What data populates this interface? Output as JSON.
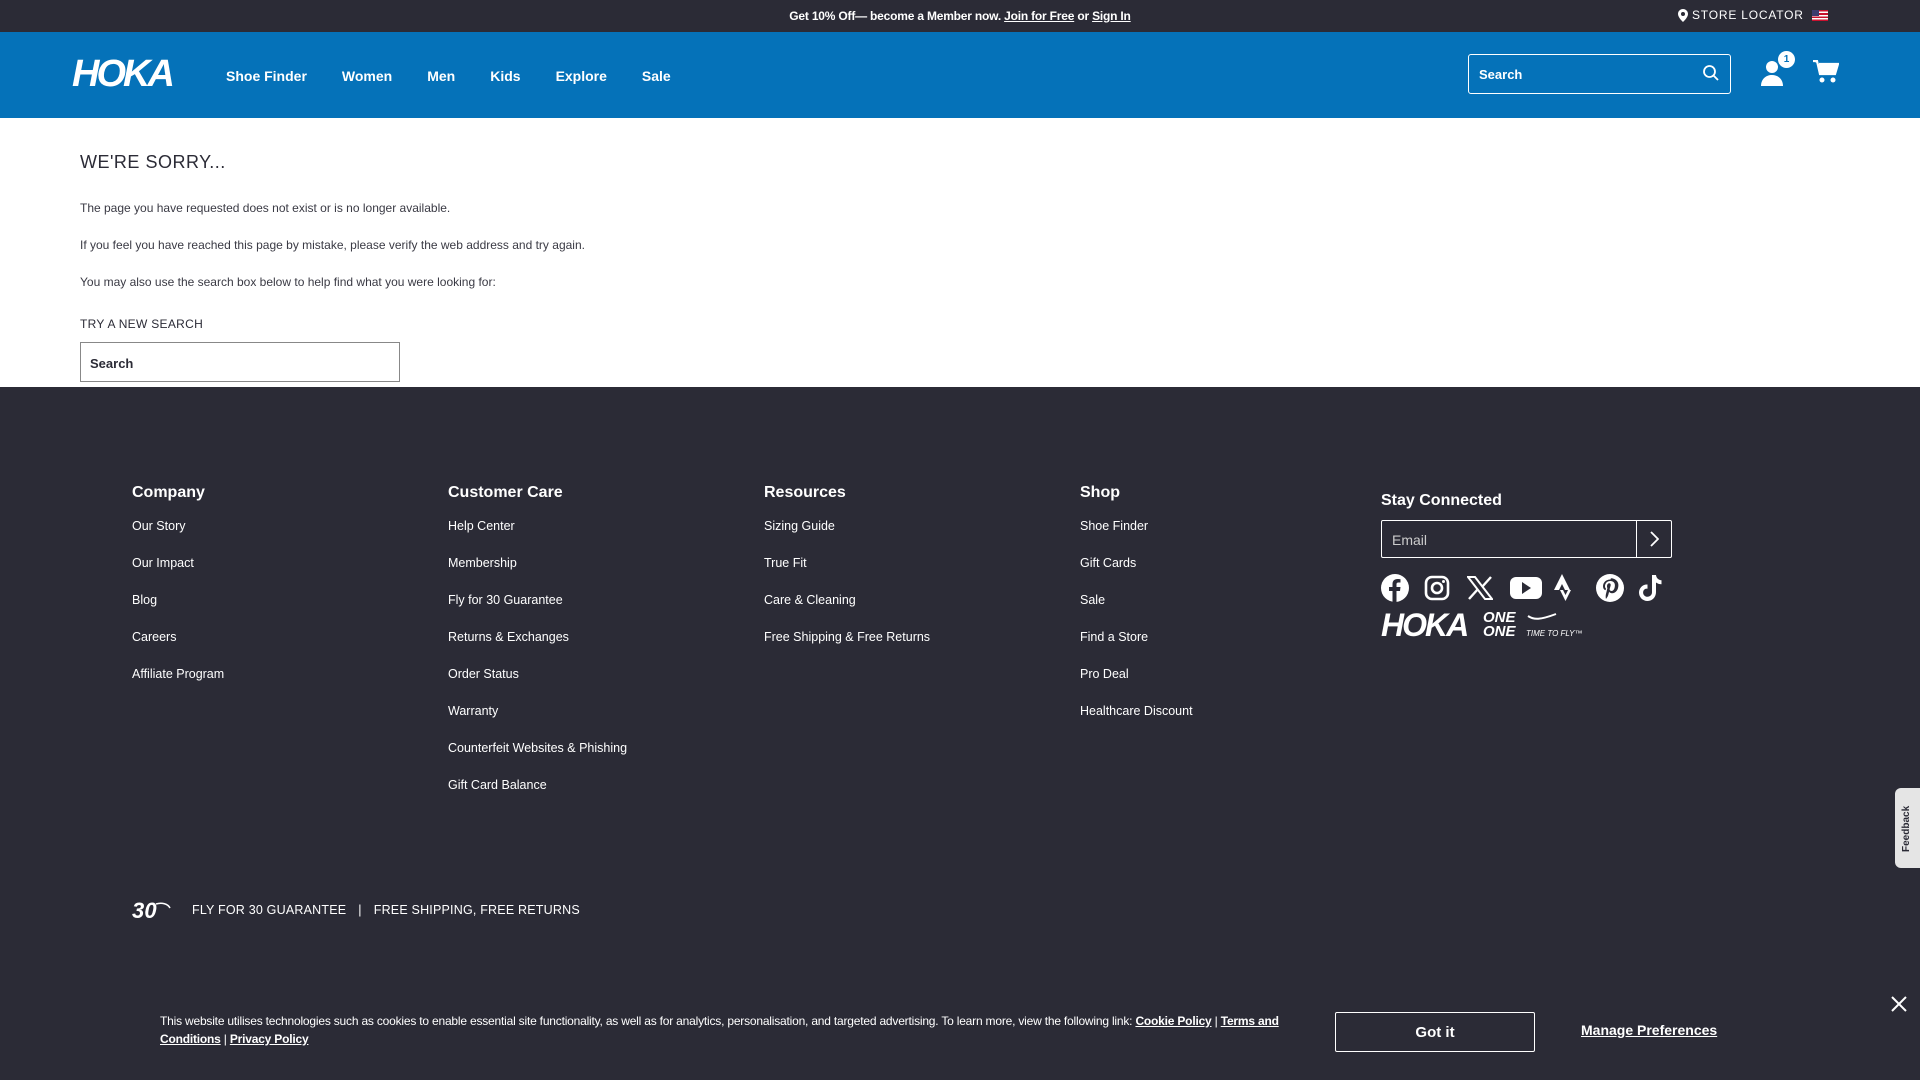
{
  "promo": {
    "text": "Get 10% Off— become a Member now. ",
    "join_link": "Join for Free",
    "or": " or ",
    "signin_link": "Sign In"
  },
  "store_locator": "STORE LOCATOR",
  "header": {
    "logo": "HOKA",
    "nav": [
      "Shoe Finder",
      "Women",
      "Men",
      "Kids",
      "Explore",
      "Sale"
    ],
    "search_placeholder": "Search",
    "cart_badge": "1"
  },
  "content": {
    "title": "WE'RE SORRY...",
    "msg1": "The page you have requested does not exist or is no longer available.",
    "msg2": "If you feel you have reached this page by mistake, please verify the web address and try again.",
    "msg3": "You may also use the search box below to help find what you were looking for:",
    "try_label": "TRY A NEW SEARCH",
    "search_placeholder": "Search"
  },
  "footer": {
    "columns": [
      {
        "heading": "Company",
        "links": [
          "Our Story",
          "Our Impact",
          "Blog",
          "Careers",
          "Affiliate Program"
        ]
      },
      {
        "heading": "Customer Care",
        "links": [
          "Help Center",
          "Membership",
          "Fly for 30 Guarantee",
          "Returns & Exchanges",
          "Order Status",
          "Warranty",
          "Counterfeit Websites & Phishing",
          "Gift Card Balance"
        ]
      },
      {
        "heading": "Resources",
        "links": [
          "Sizing Guide",
          "True Fit",
          "Care & Cleaning",
          "Free Shipping & Free Returns"
        ]
      },
      {
        "heading": "Shop",
        "links": [
          "Shoe Finder",
          "Gift Cards",
          "Sale",
          "Find a Store",
          "Pro Deal",
          "Healthcare Discount"
        ]
      }
    ],
    "stay_connected": "Stay Connected",
    "email_placeholder": "Email",
    "social": [
      "facebook-icon",
      "instagram-icon",
      "x-icon",
      "youtube-icon",
      "strava-icon",
      "pinterest-icon",
      "tiktok-icon"
    ],
    "brand_logo": "HOKA ONE ONE",
    "brand_tagline": "TIME TO FLY™",
    "guarantee_badge": "30",
    "guarantee_text": "FLY FOR 30 GUARANTEE",
    "guarantee_sep": "|",
    "shipping_text": "FREE SHIPPING, FREE RETURNS"
  },
  "cookie": {
    "text": "This website utilises technologies such as cookies to enable essential site functionality, as well as for analytics, personalisation, and targeted advertising. To learn more, view the following link: ",
    "cookie_policy": "Cookie Policy",
    "sep": " | ",
    "terms": "Terms and Conditions",
    "privacy": "Privacy Policy",
    "got_it": "Got it",
    "manage": "Manage Preferences"
  },
  "feedback": "Feedback",
  "colors": {
    "header_blue": "#0572b9",
    "dark": "#2b2b36"
  }
}
